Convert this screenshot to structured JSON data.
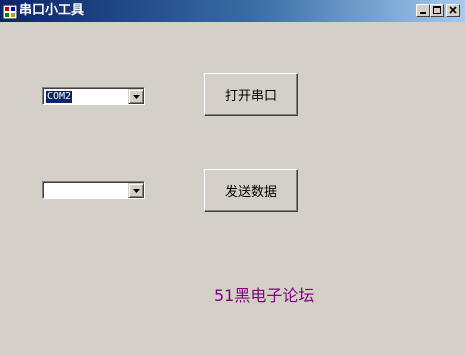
{
  "window": {
    "title": "串口小工具"
  },
  "title_buttons": {
    "minimize_icon": "minimize-icon",
    "maximize_icon": "maximize-icon",
    "close_icon": "close-icon"
  },
  "port_select": {
    "value": "COM2"
  },
  "data_select": {
    "value": ""
  },
  "buttons": {
    "open_port": "打开串口",
    "send_data": "发送数据"
  },
  "footer": {
    "label": "51黑电子论坛"
  },
  "colors": {
    "window_bg": "#d4d0c8",
    "title_start": "#0a246a",
    "title_end": "#a6caf0",
    "footer_text": "#800080",
    "selection": "#0a246a"
  }
}
